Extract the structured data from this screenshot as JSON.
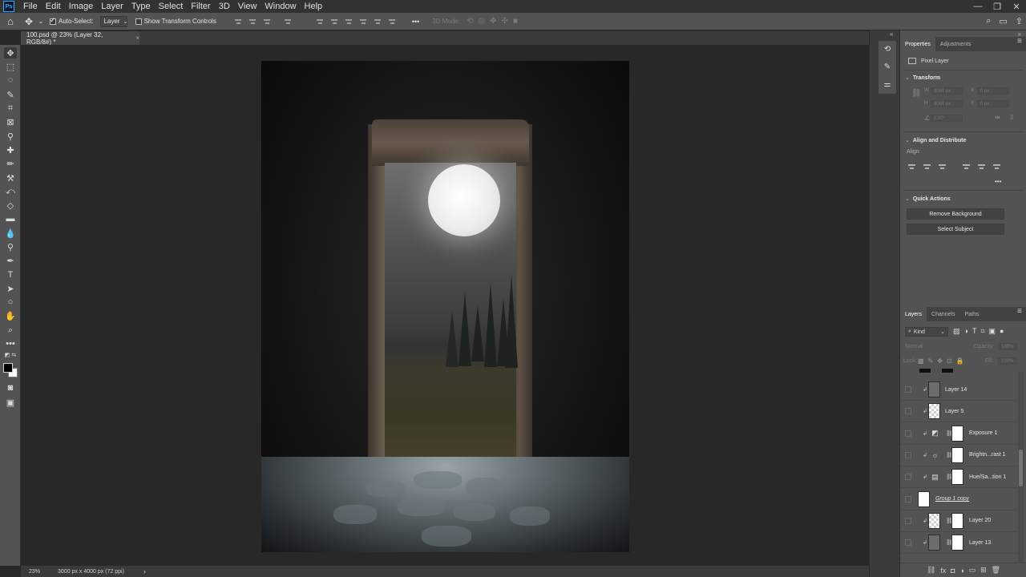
{
  "app": {
    "logo": "Ps"
  },
  "menu": [
    "File",
    "Edit",
    "Image",
    "Layer",
    "Type",
    "Select",
    "Filter",
    "3D",
    "View",
    "Window",
    "Help"
  ],
  "options": {
    "auto_select_label": "Auto-Select:",
    "auto_select_checked": true,
    "target_select": "Layer",
    "show_transform_label": "Show Transform Controls",
    "mode_3d_label": "3D Mode:",
    "more": "•••"
  },
  "document": {
    "tab_title": "100.psd @ 23% (Layer 32, RGB/8#) *",
    "tab_close": "×",
    "zoom": "23%",
    "doc_info": "3000 px x 4000 px (72 ppi)",
    "status_arrow": "›"
  },
  "properties": {
    "tabs": [
      "Properties",
      "Adjustments"
    ],
    "pixel_layer_label": "Pixel Layer",
    "transform": {
      "title": "Transform",
      "w_label": "W",
      "w_value": "3000 px",
      "h_label": "H",
      "h_value": "4000 px",
      "x_label": "X",
      "x_value": "0 px",
      "y_label": "Y",
      "y_value": "0 px",
      "angle_value": "0.00°"
    },
    "align": {
      "title": "Align and Distribute",
      "align_label": "Align:",
      "more": "•••"
    },
    "quick_actions": {
      "title": "Quick Actions",
      "remove_bg": "Remove Background",
      "select_subject": "Select Subject"
    }
  },
  "layers_panel": {
    "tabs": [
      "Layers",
      "Channels",
      "Paths"
    ],
    "filter_kind": "Kind",
    "blend_mode": "Normal",
    "opacity_label": "Opacity:",
    "opacity_value": "100%",
    "lock_label": "Lock:",
    "fill_label": "Fill:",
    "fill_value": "100%",
    "layers": [
      {
        "name": "Layer 14",
        "thumb": "grey",
        "clip": true,
        "mask": false,
        "adj": ""
      },
      {
        "name": "Layer 5",
        "thumb": "checker",
        "clip": true,
        "mask": false,
        "adj": ""
      },
      {
        "name": "Exposure 1",
        "thumb": "none",
        "clip": true,
        "mask": true,
        "adj": "◩"
      },
      {
        "name": "Brightn...rast 1",
        "thumb": "none",
        "clip": true,
        "mask": true,
        "adj": "☼"
      },
      {
        "name": "Hue/Sa...tion 1",
        "thumb": "none",
        "clip": true,
        "mask": true,
        "adj": "▤"
      },
      {
        "name": "Group 1 copy",
        "thumb": "white",
        "clip": false,
        "mask": false,
        "adj": ""
      },
      {
        "name": "Layer 20",
        "thumb": "checker",
        "clip": true,
        "mask": true,
        "adj": ""
      },
      {
        "name": "Layer 13",
        "thumb": "grey",
        "clip": true,
        "mask": true,
        "adj": ""
      }
    ],
    "footer_icons": [
      "⛓",
      "fx",
      "◘",
      "◑",
      "▭",
      "⊞",
      "🗑"
    ]
  },
  "colors": {
    "chrome_dark": "#323232",
    "chrome_mid": "#535353",
    "canvas_bg": "#282828",
    "accent": "#31a8ff"
  }
}
